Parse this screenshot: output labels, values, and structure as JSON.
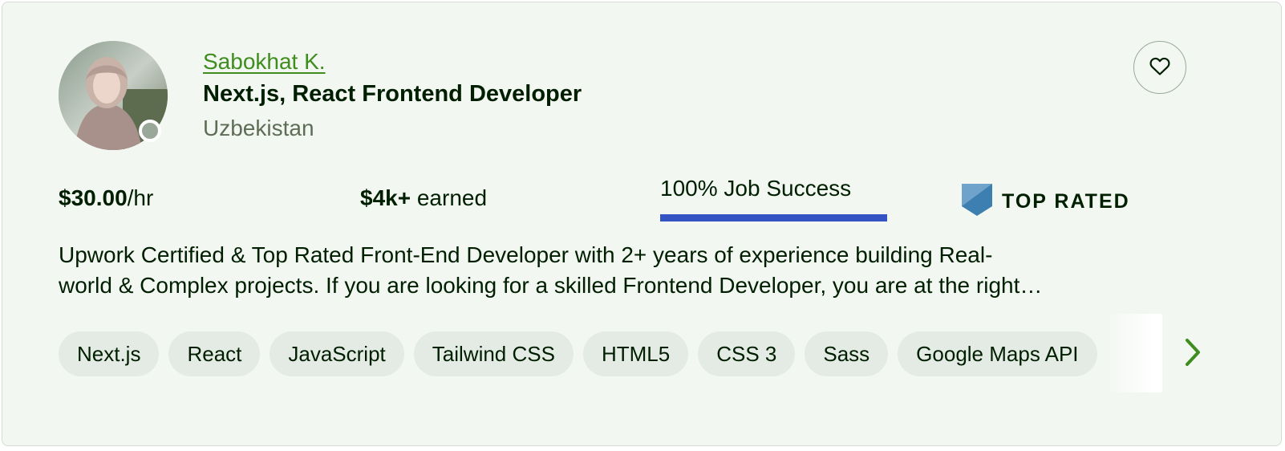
{
  "freelancer": {
    "name": "Sabokhat K.",
    "title": "Next.js, React Frontend Developer",
    "location": "Uzbekistan"
  },
  "stats": {
    "rate_amount": "$30.00",
    "rate_unit": "/hr",
    "earned_amount": "$4k+",
    "earned_label": " earned",
    "job_success": "100% Job Success",
    "job_success_percent": 100,
    "badge_label": "TOP RATED"
  },
  "description": {
    "line1": "Upwork Certified & Top Rated Front-End Developer with 2+ years of experience building Real-",
    "line2": "world & Complex projects. If you are looking for a skilled Frontend Developer, you are at the right…"
  },
  "skills": [
    "Next.js",
    "React",
    "JavaScript",
    "Tailwind CSS",
    "HTML5",
    "CSS 3",
    "Sass",
    "Google Maps API"
  ],
  "icons": {
    "favorite": "heart-icon",
    "badge": "top-rated-shield-icon",
    "next": "chevron-right-icon",
    "status": "online-status-dot"
  },
  "colors": {
    "name_link": "#3f8d1f",
    "job_success_bar": "#3454c4",
    "badge": "#3d7fb0",
    "chevron": "#3f8d1f",
    "card_bg": "#f2f7f2",
    "chip_bg": "#e4eae4"
  }
}
